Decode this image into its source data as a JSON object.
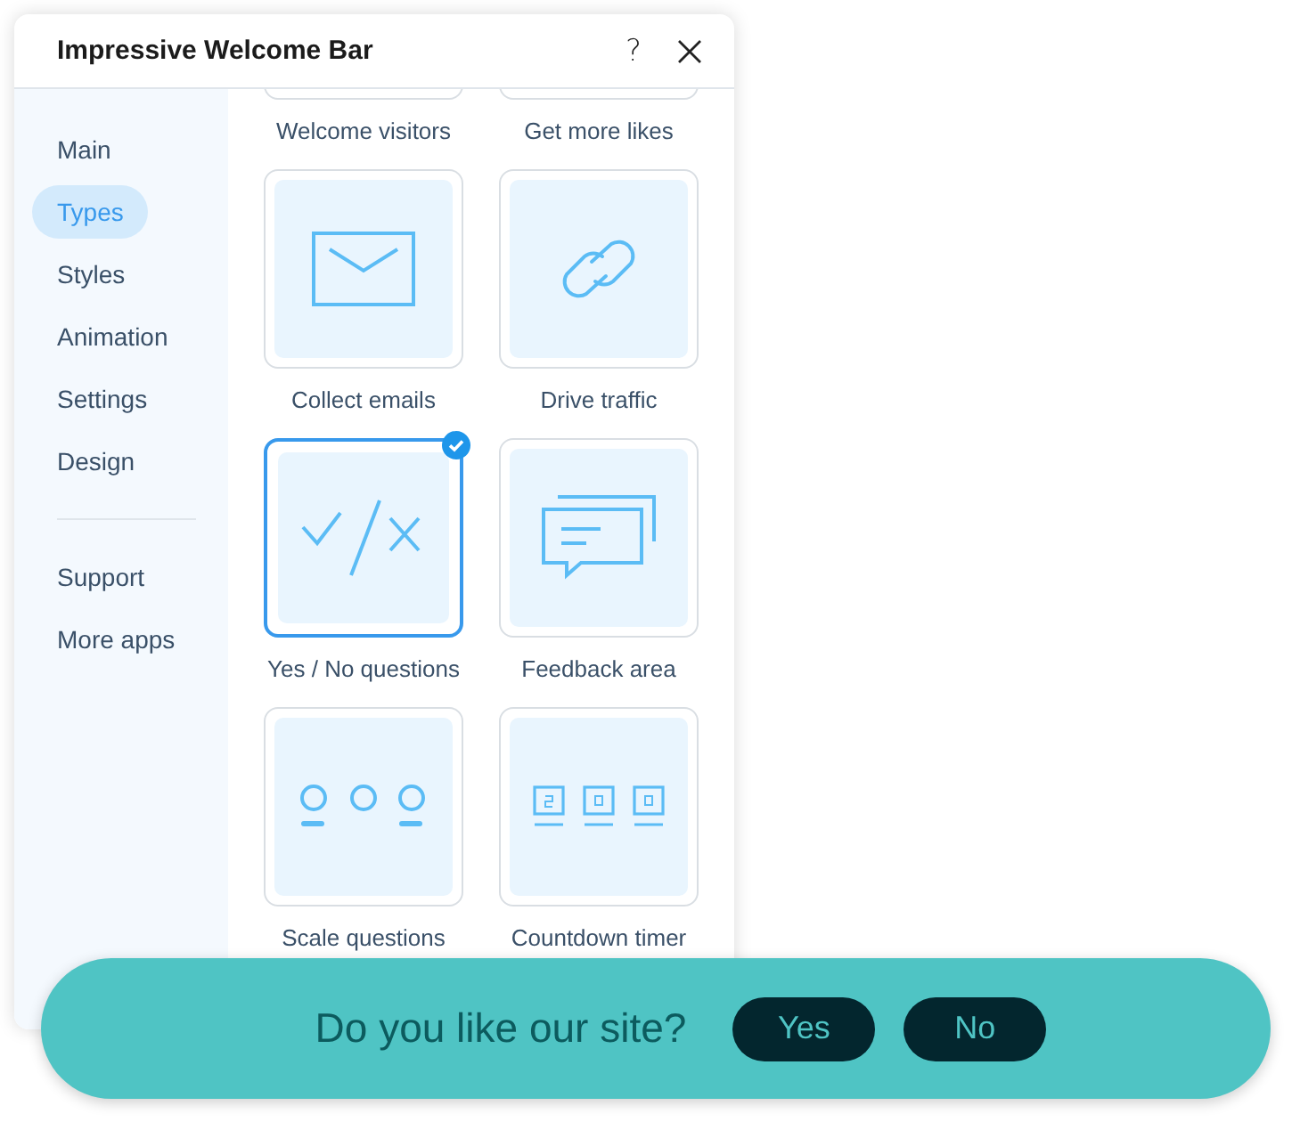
{
  "window": {
    "title": "Impressive Welcome Bar",
    "help": "?"
  },
  "sidebar": {
    "items": [
      {
        "label": "Main",
        "selected": false
      },
      {
        "label": "Types",
        "selected": true
      },
      {
        "label": "Styles",
        "selected": false
      },
      {
        "label": "Animation",
        "selected": false
      },
      {
        "label": "Settings",
        "selected": false
      },
      {
        "label": "Design",
        "selected": false
      }
    ],
    "bottom_items": [
      {
        "label": "Support",
        "selected": false
      },
      {
        "label": "More apps",
        "selected": false
      }
    ]
  },
  "types": [
    {
      "label": "Welcome visitors",
      "selected": false
    },
    {
      "label": "Get more likes",
      "selected": false
    },
    {
      "label": "Collect emails",
      "kind": "email",
      "selected": false
    },
    {
      "label": "Drive traffic",
      "kind": "link",
      "selected": false
    },
    {
      "label": "Yes / No questions",
      "kind": "yesno",
      "selected": true
    },
    {
      "label": "Feedback area",
      "kind": "feedback",
      "selected": false
    },
    {
      "label": "Scale questions",
      "kind": "scale",
      "selected": false
    },
    {
      "label": "Countdown timer",
      "kind": "countdown",
      "selected": false
    }
  ],
  "preview_bar": {
    "text": "Do you like our site?",
    "buttons": [
      "Yes",
      "No"
    ]
  }
}
